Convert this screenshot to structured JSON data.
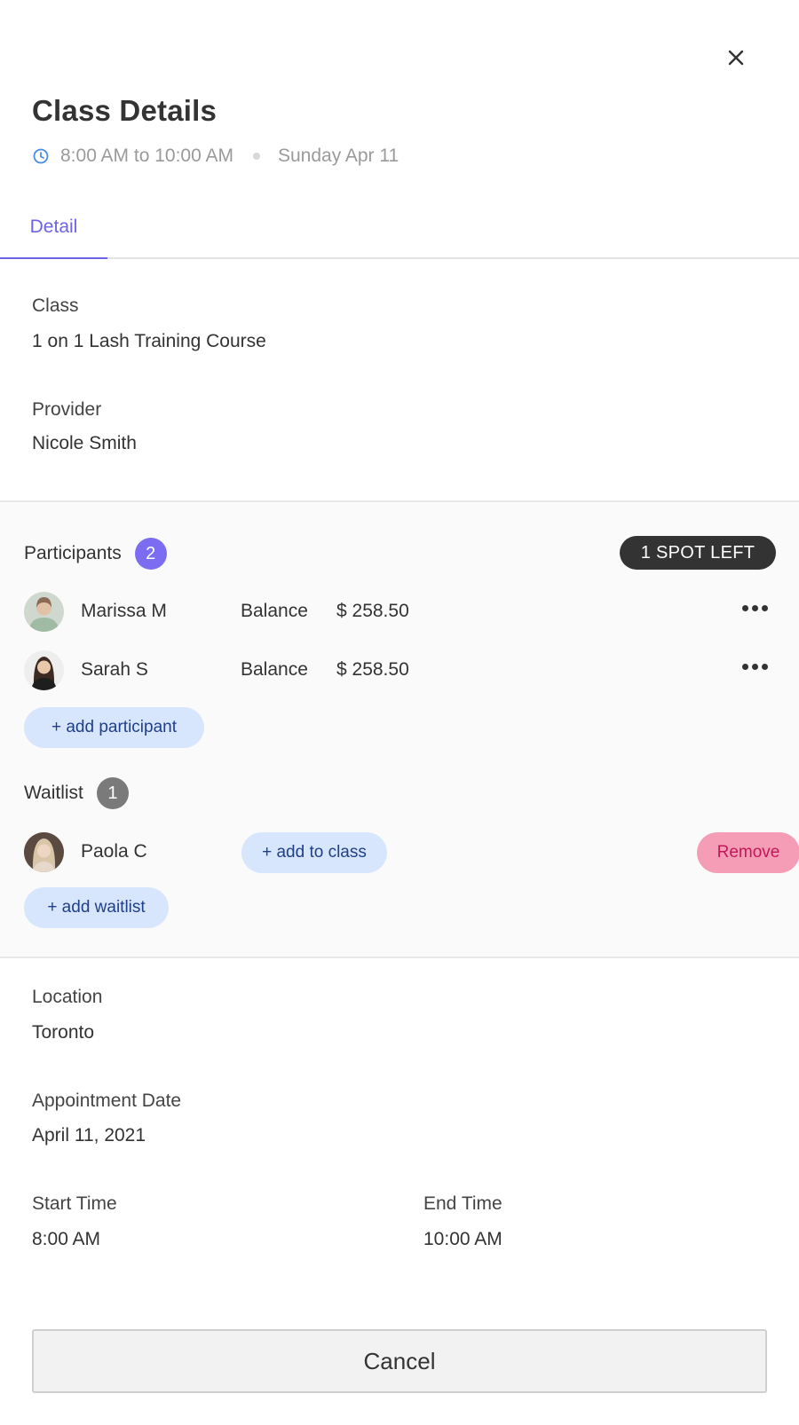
{
  "header": {
    "title": "Class Details",
    "time_range": "8:00 AM to 10:00 AM",
    "date": "Sunday Apr 11"
  },
  "tabs": [
    {
      "label": "Detail",
      "active": true
    }
  ],
  "class_field": {
    "label": "Class",
    "value": "1 on 1 Lash Training Course"
  },
  "provider_field": {
    "label": "Provider",
    "value": "Nicole Smith"
  },
  "participants": {
    "label": "Participants",
    "count": "2",
    "spots_badge": "1 SPOT LEFT",
    "items": [
      {
        "name": "Marissa M",
        "balance_label": "Balance",
        "balance_value": "$ 258.50"
      },
      {
        "name": "Sarah S",
        "balance_label": "Balance",
        "balance_value": "$ 258.50"
      }
    ],
    "add_label": "+ add participant"
  },
  "waitlist": {
    "label": "Waitlist",
    "count": "1",
    "items": [
      {
        "name": "Paola C",
        "add_to_class_label": "+ add to class",
        "remove_label": "Remove"
      }
    ],
    "add_label": "+ add waitlist"
  },
  "location_field": {
    "label": "Location",
    "value": "Toronto"
  },
  "appointment_date_field": {
    "label": "Appointment Date",
    "value": "April 11, 2021"
  },
  "start_time_field": {
    "label": "Start Time",
    "value": "8:00 AM"
  },
  "end_time_field": {
    "label": "End Time",
    "value": "10:00 AM"
  },
  "footer": {
    "cancel_label": "Cancel"
  },
  "colors": {
    "accent": "#6c63e8",
    "participants_badge": "#7c6cf2",
    "waitlist_badge": "#7a7a7a",
    "pill_bg": "#d8e6fd",
    "remove_bg": "#f59db7",
    "spots_badge_bg": "#333333"
  },
  "icons": {
    "close": "close-icon",
    "clock": "clock-icon",
    "more": "more-horizontal-icon"
  }
}
